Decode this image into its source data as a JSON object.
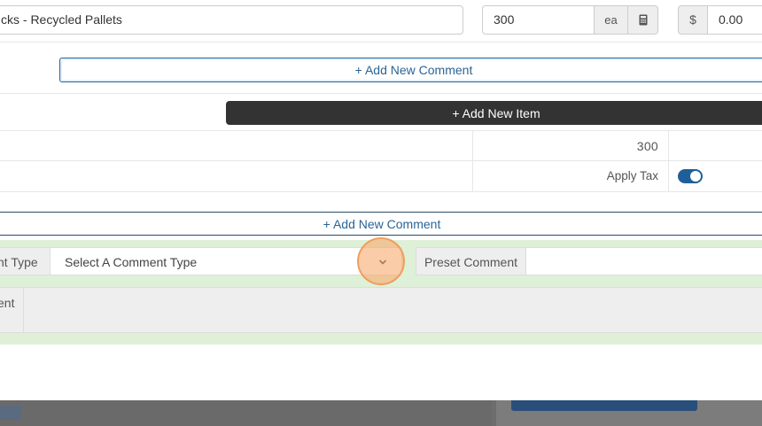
{
  "item": {
    "name_value": "cks - Recycled Pallets",
    "quantity_value": "300",
    "unit_label": "ea",
    "price_symbol": "$",
    "price_value": "0.00"
  },
  "item_comment": {
    "add_label": "+ Add New Comment"
  },
  "items": {
    "add_item_label": "+ Add New Item"
  },
  "totals": {
    "quantity_total": "300",
    "apply_tax_label": "Apply Tax",
    "apply_tax_on": true
  },
  "order_comment": {
    "add_label": "+ Add New Comment",
    "comment_type_label": "nt Type",
    "comment_type_placeholder": "Select A Comment Type",
    "preset_comment_label": "Preset Comment",
    "comment_label": "ent"
  },
  "colors": {
    "accent": "#2a6496",
    "dark_button": "#333333",
    "toggle_on": "#1f5f99",
    "panel_green": "#dff0d8"
  },
  "icons": {
    "calculator": "calculator-icon",
    "chevron": "chevron-down-icon"
  }
}
